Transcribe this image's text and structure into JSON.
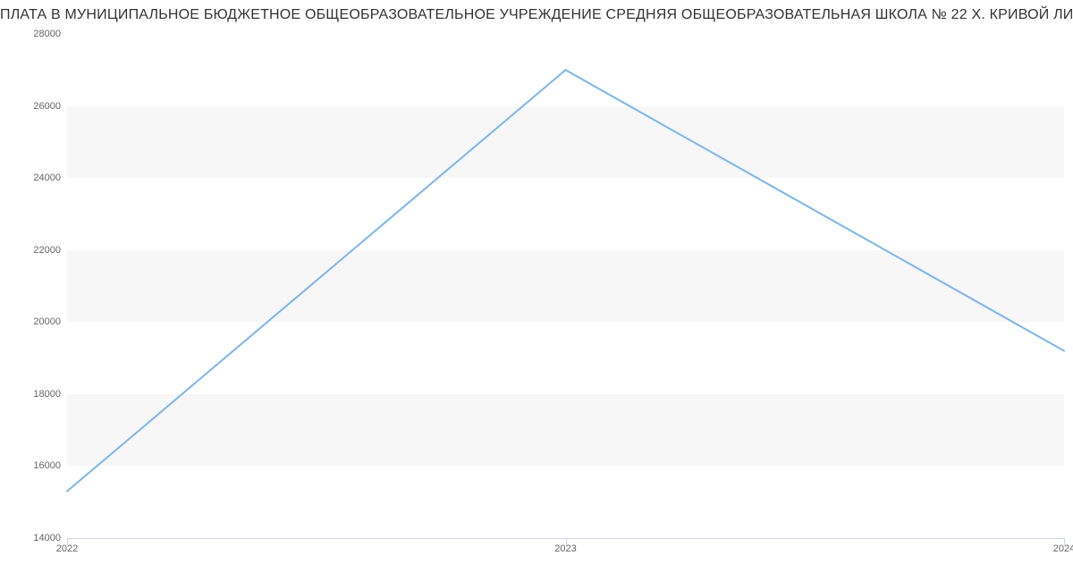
{
  "chart_data": {
    "type": "line",
    "title": "ПЛАТА В МУНИЦИПАЛЬНОЕ БЮДЖЕТНОЕ ОБЩЕОБРАЗОВАТЕЛЬНОЕ УЧРЕЖДЕНИЕ СРЕДНЯЯ ОБЩЕОБРАЗОВАТЕЛЬНАЯ ШКОЛА № 22 Х. КРИВОЙ ЛИМАН | Данные mnogo.w",
    "xlabel": "",
    "ylabel": "",
    "x": [
      "2022",
      "2023",
      "2024"
    ],
    "values": [
      15300,
      27000,
      19200
    ],
    "ylim": [
      14000,
      28000
    ],
    "y_ticks": [
      14000,
      16000,
      18000,
      20000,
      22000,
      24000,
      26000,
      28000
    ],
    "x_ticks": [
      "2022",
      "2023",
      "2024"
    ]
  },
  "colors": {
    "line": "#7cb5ec",
    "band": "#f7f7f7",
    "axis": "#ccd6eb",
    "tick_text": "#666"
  }
}
